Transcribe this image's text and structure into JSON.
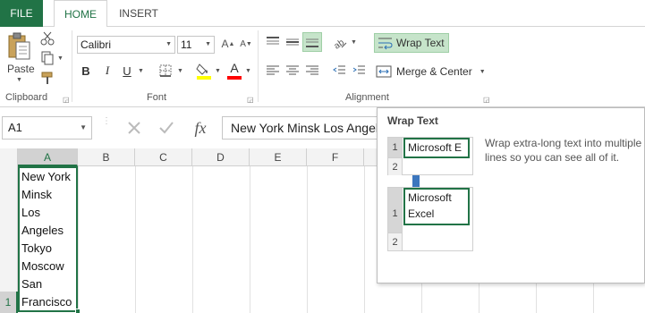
{
  "tabs": {
    "file": "FILE",
    "home": "HOME",
    "insert": "INSERT"
  },
  "ribbon": {
    "clipboard": {
      "paste_label": "Paste",
      "group_label": "Clipboard"
    },
    "font": {
      "font_name": "Calibri",
      "font_size": "11",
      "bold": "B",
      "italic": "I",
      "underline": "U",
      "group_label": "Font"
    },
    "alignment": {
      "wrap_text_label": "Wrap Text",
      "merge_center_label": "Merge & Center",
      "group_label": "Alignment"
    }
  },
  "formula_bar": {
    "name_box": "A1",
    "fx": "fx",
    "content": "New York Minsk Los Angeles Tokyo Moscow San Francisco"
  },
  "grid": {
    "columns": [
      "A",
      "B",
      "C",
      "D",
      "E",
      "F"
    ],
    "row_number": "1",
    "cell_a1_lines": [
      "New York",
      "Minsk",
      "Los",
      "Angeles",
      "Tokyo",
      "Moscow",
      "San",
      "Francisco"
    ]
  },
  "tooltip": {
    "title": "Wrap Text",
    "description": "Wrap extra-long text into multiple lines so you can see all of it.",
    "before_row1": "1",
    "before_row2": "2",
    "before_cell": "Microsoft E",
    "after_row1": "1",
    "after_row2": "2",
    "after_line1": "Microsoft",
    "after_line2": "Excel"
  },
  "colors": {
    "accent": "#217346",
    "highlight_yellow": "#ffff00",
    "font_red": "#ff0000",
    "arrow_blue": "#3c76be"
  }
}
